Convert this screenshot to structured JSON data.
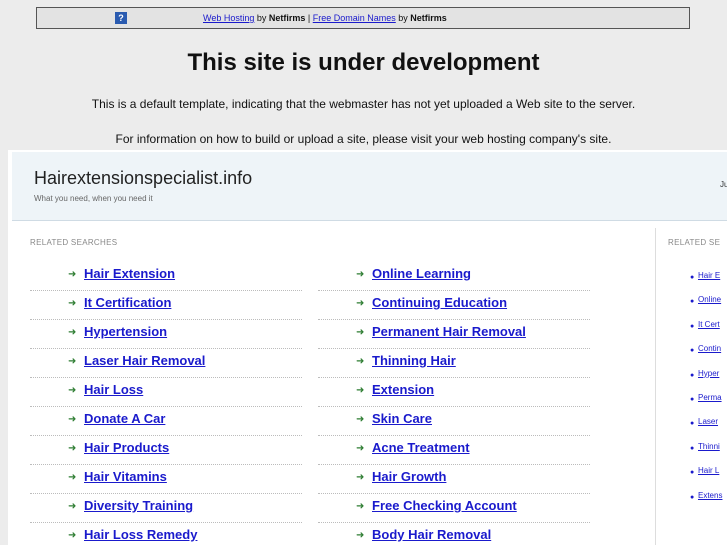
{
  "topbar": {
    "link1": "Web Hosting",
    "by1": " by ",
    "brand1": "Netfirms",
    "sep": " | ",
    "link2": "Free Domain Names",
    "by2": " by ",
    "brand2": "Netfirms"
  },
  "title": "This site is under development",
  "message1": "This is a default template, indicating that the webmaster has not yet uploaded a Web site to the server.",
  "message2": "For information on how to build or upload a site, please visit your web hosting company's site.",
  "header": {
    "site_name": "Hairextensionspecialist.info",
    "tagline": "What you need, when you need it",
    "right_text": "Ju"
  },
  "related_label": "RELATED SEARCHES",
  "right_related_label": "RELATED SE",
  "left_column": [
    "Hair Extension",
    "It Certification",
    "Hypertension",
    "Laser Hair Removal",
    "Hair Loss",
    "Donate A Car",
    "Hair Products",
    "Hair Vitamins",
    "Diversity Training",
    "Hair Loss Remedy"
  ],
  "middle_column": [
    "Online Learning",
    "Continuing Education",
    "Permanent Hair Removal",
    "Thinning Hair",
    "Extension",
    "Skin Care",
    "Acne Treatment",
    "Hair Growth",
    "Free Checking Account",
    "Body Hair Removal"
  ],
  "right_column": [
    "Hair E",
    "Online",
    "It Cert",
    "Contin",
    "Hyper",
    "Perma",
    "Laser",
    "Thinni",
    "Hair L",
    "Extens"
  ],
  "colors": {
    "link": "#1a1acc",
    "arrow": "#2e7d32",
    "header_bg": "#eef4f8",
    "page_bg": "#ececec"
  }
}
